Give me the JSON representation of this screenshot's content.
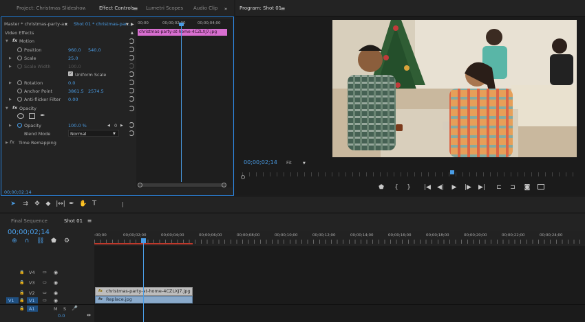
{
  "top_tabs": {
    "project": "Project: Christmas Slideshow_1",
    "effect_controls": "Effect Controls",
    "lumetri": "Lumetri Scopes",
    "audio_clip": "Audio Clip I",
    "program": "Program: Shot 01"
  },
  "effect_controls": {
    "master": "Master * christmas-party-a...",
    "sequence": "Shot 01 * christmas-par...",
    "section_title": "Video Effects",
    "clip_label": "christmas-party-at-home-4CZLXJ7.jpg",
    "ruler": [
      "00;00",
      "00;00;02;00",
      "00;00;04;00"
    ],
    "motion": "Motion",
    "position_label": "Position",
    "position_x": "960.0",
    "position_y": "540.0",
    "scale_label": "Scale",
    "scale_val": "25.0",
    "scale_width_label": "Scale Width",
    "scale_width_val": "100.0",
    "uniform_scale": "Uniform Scale",
    "rotation_label": "Rotation",
    "rotation_val": "0.0",
    "anchor_label": "Anchor Point",
    "anchor_x": "3861.5",
    "anchor_y": "2574.5",
    "antiflicker_label": "Anti-flicker Filter",
    "antiflicker_val": "0.00",
    "opacity_section": "Opacity",
    "opacity_label": "Opacity",
    "opacity_val": "100.0 %",
    "opacity_kf": "0",
    "blend_label": "Blend Mode",
    "blend_val": "Normal",
    "time_remap": "Time Remapping",
    "timecode": "00;00;02;14"
  },
  "program": {
    "timecode": "00;00;02;14",
    "fit": "Fit"
  },
  "timeline": {
    "tab_final": "Final Sequence",
    "tab_shot": "Shot 01",
    "timecode": "00;00;02;14",
    "ruler": [
      ":00;00",
      "00;00;02;00",
      "00;00;04;00",
      "00;00;06;00",
      "00;00;08;00",
      "00;00;10;00",
      "00;00;12;00",
      "00;00;14;00",
      "00;00;16;00",
      "00;00;18;00",
      "00;00;20;00",
      "00;00;22;00",
      "00;00;24;00"
    ],
    "tracks": {
      "v4": "V4",
      "v3": "V3",
      "v2": "V2",
      "v1": "V1",
      "v1_src": "V1",
      "a1": "A1",
      "a1_src": "A1",
      "m": "M",
      "s": "S",
      "vol": "0.0"
    },
    "clip_v2": "christmas-party-at-home-4CZLXJ7.jpg",
    "clip_v1": "Replace.jpg",
    "fx_badge": "fx"
  },
  "colors": {
    "accent": "#4a9de6",
    "clip_pink": "#d86fd0",
    "clip_v2": "#bdbdbd",
    "clip_v1": "#8aaacb",
    "work_area": "#c0392b"
  }
}
